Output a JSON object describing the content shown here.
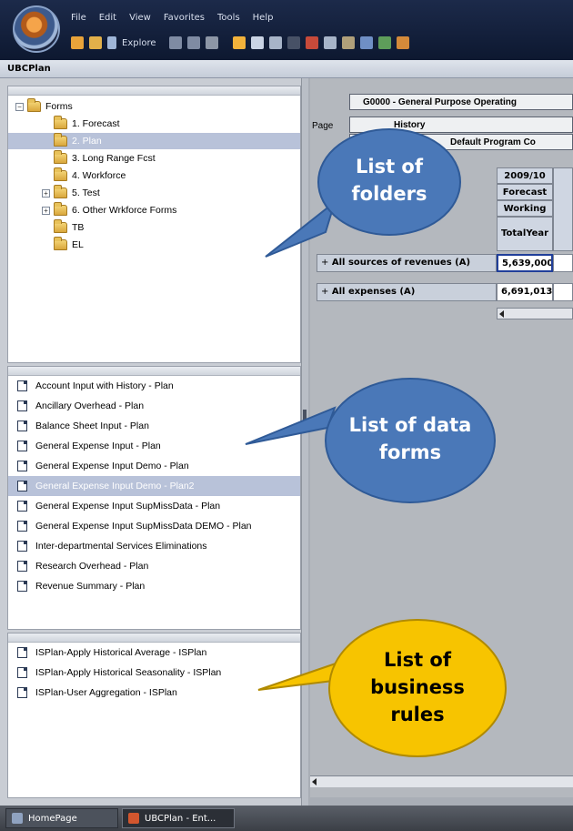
{
  "window": {
    "menus": [
      "File",
      "Edit",
      "View",
      "Favorites",
      "Tools",
      "Help"
    ],
    "toolbar_explore": "Explore",
    "app_title": "UBCPlan"
  },
  "folders": {
    "root": "Forms",
    "items": [
      {
        "label": "1. Forecast",
        "expandable": false,
        "selected": false
      },
      {
        "label": "2. Plan",
        "expandable": false,
        "selected": true
      },
      {
        "label": "3. Long Range Fcst",
        "expandable": false,
        "selected": false
      },
      {
        "label": "4. Workforce",
        "expandable": false,
        "selected": false
      },
      {
        "label": "5. Test",
        "expandable": true,
        "selected": false
      },
      {
        "label": "6. Other Wrkforce Forms",
        "expandable": true,
        "selected": false
      },
      {
        "label": "TB",
        "expandable": false,
        "selected": false
      },
      {
        "label": "EL",
        "expandable": false,
        "selected": false
      }
    ]
  },
  "data_forms": [
    {
      "label": "Account Input with History - Plan",
      "selected": false
    },
    {
      "label": "Ancillary Overhead - Plan",
      "selected": false
    },
    {
      "label": "Balance Sheet Input - Plan",
      "selected": false
    },
    {
      "label": "General Expense Input - Plan",
      "selected": false
    },
    {
      "label": "General Expense Input Demo - Plan",
      "selected": false
    },
    {
      "label": "General Expense Input Demo - Plan2",
      "selected": true
    },
    {
      "label": "General Expense Input SupMissData - Plan",
      "selected": false
    },
    {
      "label": "General Expense Input SupMissData DEMO - Plan",
      "selected": false
    },
    {
      "label": "Inter-departmental Services Eliminations",
      "selected": false
    },
    {
      "label": "Research Overhead - Plan",
      "selected": false
    },
    {
      "label": "Revenue Summary - Plan",
      "selected": false
    }
  ],
  "business_rules": [
    "ISPlan-Apply Historical Average - ISPlan",
    "ISPlan-Apply Historical Seasonality - ISPlan",
    "ISPlan-User Aggregation - ISPlan"
  ],
  "form": {
    "pov": "G0000 - General Purpose Operating",
    "page_label": "Page",
    "page_value": "History",
    "page_value2": "Default Program Co",
    "col_year": "2009/10",
    "col_scenario": "Forecast",
    "col_version": "Working",
    "col_period": "TotalYear",
    "rows": [
      {
        "label": "All sources of revenues (A)",
        "value": "5,639,000"
      },
      {
        "label": "All expenses (A)",
        "value": "6,691,013"
      }
    ]
  },
  "taskbar": {
    "home": "HomePage",
    "active": "UBCPlan - Ent..."
  },
  "callouts": {
    "folders": [
      "List of",
      "folders"
    ],
    "data_forms": [
      "List of data",
      "forms"
    ],
    "business_rules": [
      "List of",
      "business",
      "rules"
    ]
  },
  "colors": {
    "callout_blue": "#4a78b8",
    "callout_yellow": "#f7c400",
    "selection": "#b8c2d9"
  }
}
